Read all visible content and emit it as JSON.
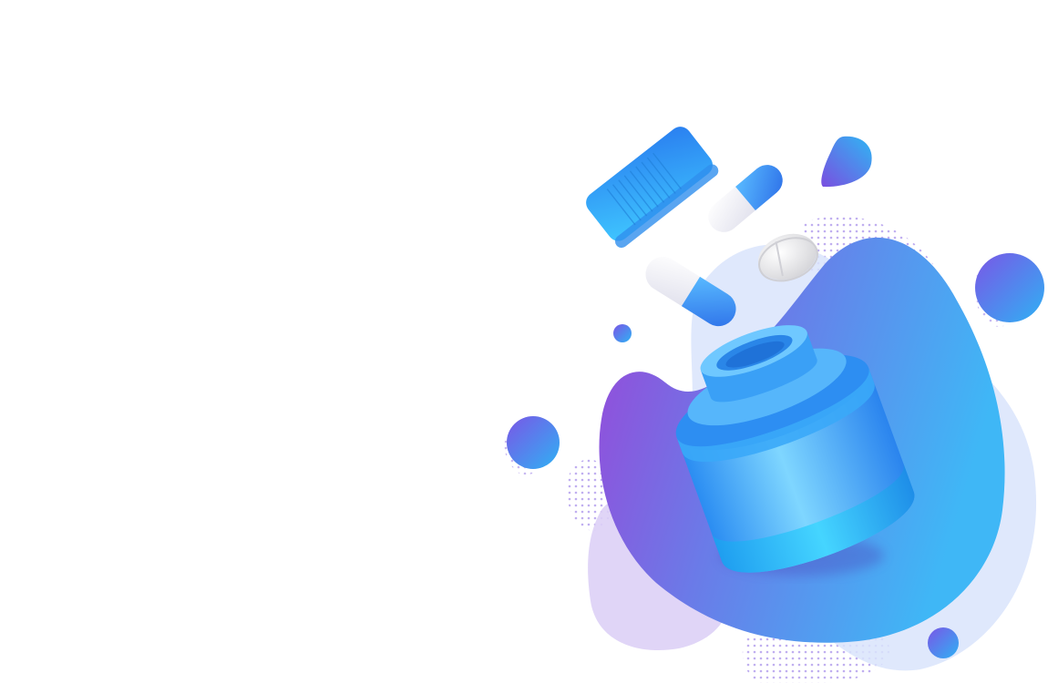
{
  "illustration": {
    "subject": "medicine-bottle-with-pills",
    "icons": [
      "bottle-icon",
      "bottle-cap-icon",
      "capsule-icon",
      "tablet-icon"
    ],
    "colors": {
      "background": "#ffffff",
      "primary_blue": "#2aa6f5",
      "deep_blue": "#2f7fe6",
      "cyan": "#33ccff",
      "purple": "#8c4fe0",
      "lavender": "#ddd0f6",
      "pale_blue": "#d9e6fb",
      "dots": "#b7a3ee",
      "capsule_white": "#f3f3f8",
      "tablet_white": "#eeeeee"
    }
  }
}
